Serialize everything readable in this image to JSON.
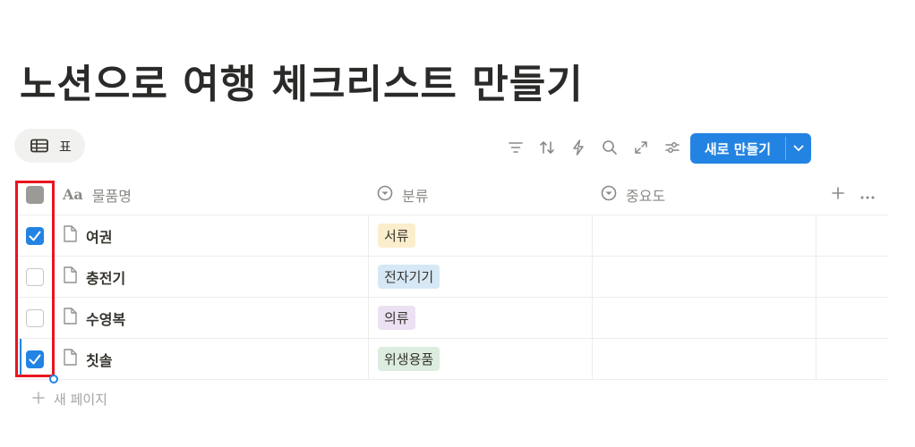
{
  "page": {
    "title": "노션으로 여행 체크리스트 만들기"
  },
  "view": {
    "tab_label": "표"
  },
  "toolbar": {
    "icons": [
      "filter-icon",
      "sort-icon",
      "automation-icon",
      "search-icon",
      "expand-icon",
      "settings-icon"
    ],
    "new_button_label": "새로 만들기"
  },
  "table": {
    "headers": {
      "name": "물품명",
      "category": "분류",
      "importance": "중요도",
      "name_type_glyph": "Aa"
    },
    "rows": [
      {
        "name": "여권",
        "checked": true,
        "category": "서류",
        "category_color": "#fbeecc"
      },
      {
        "name": "충전기",
        "checked": false,
        "category": "전자기기",
        "category_color": "#d6e8f5"
      },
      {
        "name": "수영복",
        "checked": false,
        "category": "의류",
        "category_color": "#ebe1f2"
      },
      {
        "name": "칫솔",
        "checked": true,
        "category": "위생용품",
        "category_color": "#dcecdf"
      }
    ],
    "add_row_label": "새 페이지"
  },
  "colors": {
    "accent": "#2383e2",
    "highlight": "#e8161f"
  }
}
